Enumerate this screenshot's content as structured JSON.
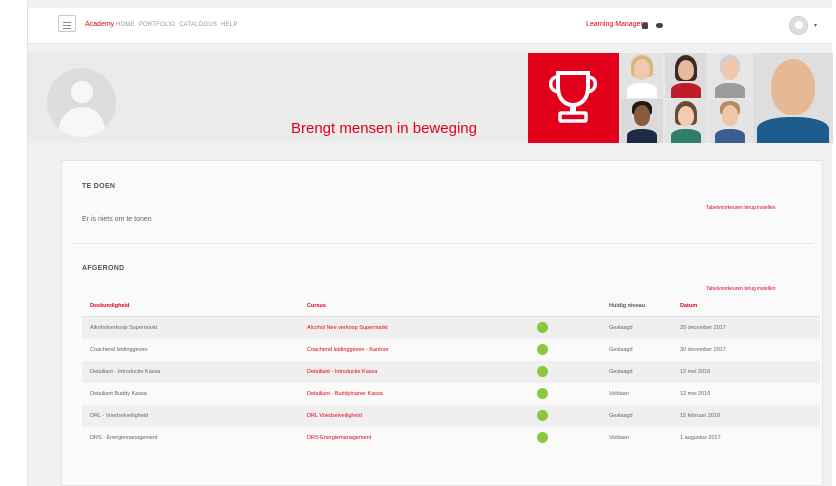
{
  "navbar": {
    "brand": "Academy",
    "links": [
      "HOME",
      "PORTFOLIO",
      "CATALOGUS",
      "HELP"
    ],
    "role_label": "Learning Manager ▾",
    "user_caret": "▾"
  },
  "header": {
    "tagline": "Brengt mensen in beweging"
  },
  "todo": {
    "title": "TE DOEN",
    "empty_text": "Er is niets om te tonen",
    "reset_link": "Tabelvoorkeuren terug instellen"
  },
  "completed": {
    "title": "AFGEROND",
    "reset_link": "Tabelvoorkeuren terug instellen",
    "columns": {
      "competence": "Deskundigheid",
      "course": "Cursus",
      "level": "Huidig niveau",
      "date": "Datum"
    },
    "rows": [
      {
        "competence": "Alkoholverkoop Supermarkt",
        "course": "Alcohol Nee verkoop Supermarkt",
        "level": "Geslaagd",
        "date": "29 december 2017"
      },
      {
        "competence": "Coachend leidinggeven",
        "course": "Coachend leidinggeven - Kantoor",
        "level": "Geslaagd",
        "date": "30 december 2017"
      },
      {
        "competence": "Detailiant - Introductie Kassa",
        "course": "Detailiant - Introductie Kassa",
        "level": "Geslaagd",
        "date": "12 mei 2016"
      },
      {
        "competence": "Detailiant Buddy Kassa",
        "course": "Detailiant - Buddytrainer Kassa",
        "level": "Voldaan",
        "date": "12 mei 2016"
      },
      {
        "competence": "DRL - Voedselveiligheid",
        "course": "DRL Voedselveiligheid",
        "level": "Geslaagd",
        "date": "15 februari 2018"
      },
      {
        "competence": "DRS - Energiemanagement",
        "course": "DRS Energiemanagement",
        "level": "Voldaan",
        "date": "1 augustus 2017"
      }
    ]
  },
  "icons": {
    "menu": "hamburger-menu-icon",
    "bell": "bell-icon",
    "chat": "chat-bubble-icon",
    "trophy": "trophy-icon",
    "status": "green-dot-icon"
  },
  "colors": {
    "accent": "#e2001a",
    "status_green": "#8dc63f"
  }
}
